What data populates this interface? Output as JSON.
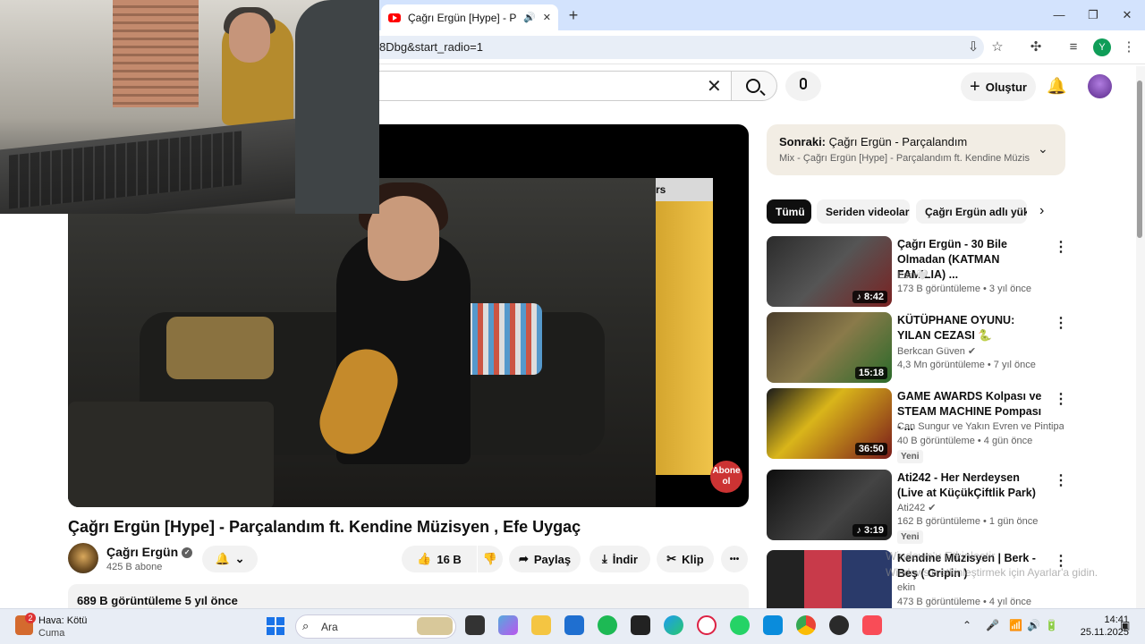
{
  "browser": {
    "tab_title": "Çağrı Ergün [Hype] - Parçala",
    "new_tab": "+",
    "url": "8Dbg&start_radio=1",
    "profile_initial": "Y",
    "window": {
      "minimize": "—",
      "restore": "❐",
      "close": "✕"
    }
  },
  "youtube_header": {
    "create_label": "Oluştur",
    "search_clear": "✕"
  },
  "video": {
    "title": "Çağrı Ergün [Hype] - Parçalandım ft. Kendine Müzisyen , Efe Uygaç",
    "channel": "Çağrı Ergün",
    "subscribers": "425 B abone",
    "likes": "16 B",
    "share_label": "Paylaş",
    "download_label": "İndir",
    "clip_label": "Klip",
    "more_label": "•••",
    "description_meta": "689 B görüntüleme  5 yıl önce",
    "overlay_caption": "rs",
    "abone_badge": "Abone ol"
  },
  "up_next": {
    "label": "Sonraki:",
    "title": "Çağrı Ergün - Parçalandım",
    "subtitle": "Mix - Çağrı Ergün [Hype] - Parçalandım ft. Kendine Müzisyen ..."
  },
  "chips": [
    "Tümü",
    "Seriden videolar",
    "Çağrı Ergün adlı yükle"
  ],
  "recommendations": [
    {
      "title": "Çağrı Ergün - 30 Bile Olmadan (KATMAN FAMILIA) ...",
      "channel": "Esin🤍",
      "meta": "173 B görüntüleme • 3 yıl önce",
      "duration": "♪ 8:42",
      "badge": ""
    },
    {
      "title": "KÜTÜPHANE OYUNU: YILAN CEZASI 🐍",
      "channel": "Berkcan Güven ✔",
      "meta": "4,3 Mn görüntüleme • 7 yıl önce",
      "duration": "15:18",
      "badge": ""
    },
    {
      "title": "GAME AWARDS Kolpası ve STEAM MACHINE Pompası - ...",
      "channel": "Can Sungur ve Yakın Evren ve Pintipanda...",
      "meta": "40 B görüntüleme • 4 gün önce",
      "duration": "36:50",
      "badge": "Yeni"
    },
    {
      "title": "Ati242 - Her Nerdeysen (Live at KüçükÇiftlik Park)",
      "channel": "Ati242 ✔",
      "meta": "162 B görüntüleme • 1 gün önce",
      "duration": "♪ 3:19",
      "badge": "Yeni"
    },
    {
      "title": "Kendine Müzisyen | Berk - Beş ( Gripin )",
      "channel": "ekin",
      "meta": "473 B görüntüleme • 4 yıl önce",
      "duration": "",
      "badge": ""
    }
  ],
  "activation": {
    "line1": "Windows'u Etkinleştir",
    "line2": "Windows'u etkinleştirmek için Ayarlar'a gidin."
  },
  "taskbar": {
    "weather_title": "Hava: Kötü",
    "weather_day": "Cuma",
    "weather_badge": "2",
    "search_placeholder": "Ara",
    "time": "14:41",
    "date": "25.11.2025"
  }
}
